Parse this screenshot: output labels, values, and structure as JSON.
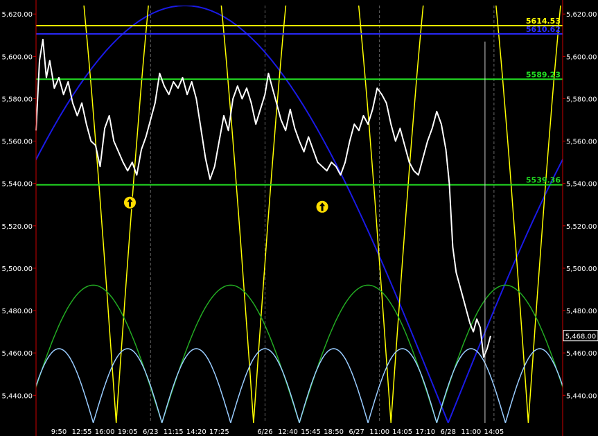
{
  "chart_data": {
    "type": "line",
    "title": "",
    "xlabel": "",
    "ylabel": "",
    "ylim": [
      5427,
      5624
    ],
    "y_ticks": [
      5440,
      5460,
      5480,
      5500,
      5520,
      5540,
      5560,
      5580,
      5600,
      5620
    ],
    "y_tick_labels": [
      "5,440.00",
      "5,460.00",
      "5,480.00",
      "5,500.00",
      "5,520.00",
      "5,540.00",
      "5,560.00",
      "5,580.00",
      "5,600.00",
      "5,620.00"
    ],
    "x_tick_labels": [
      "9:50",
      "12:55",
      "16:00",
      "19:05",
      "6/23",
      "11:15",
      "14:20",
      "17:25",
      "6/26",
      "12:40",
      "15:45",
      "18:50",
      "6/27",
      "11:00",
      "14:05",
      "17:10",
      "6/28",
      "11:00",
      "14:05"
    ],
    "session_separators": [
      5,
      10,
      15,
      20
    ],
    "x_range": [
      0,
      23
    ],
    "x_tick_positions": [
      1,
      2,
      3,
      4,
      5,
      6,
      7,
      8,
      10,
      11,
      12,
      13,
      14,
      15,
      16,
      17,
      18,
      19,
      20
    ],
    "price_series": {
      "name": "",
      "color": "#ffffff",
      "points": [
        [
          0,
          5565
        ],
        [
          0.15,
          5598
        ],
        [
          0.3,
          5608
        ],
        [
          0.45,
          5590
        ],
        [
          0.6,
          5598
        ],
        [
          0.8,
          5585
        ],
        [
          1.0,
          5590
        ],
        [
          1.2,
          5582
        ],
        [
          1.4,
          5588
        ],
        [
          1.6,
          5578
        ],
        [
          1.8,
          5572
        ],
        [
          2.0,
          5578
        ],
        [
          2.2,
          5568
        ],
        [
          2.4,
          5560
        ],
        [
          2.6,
          5558
        ],
        [
          2.8,
          5548
        ],
        [
          3.0,
          5566
        ],
        [
          3.2,
          5572
        ],
        [
          3.4,
          5560
        ],
        [
          3.6,
          5555
        ],
        [
          3.8,
          5550
        ],
        [
          4.0,
          5546
        ],
        [
          4.2,
          5550
        ],
        [
          4.4,
          5544
        ],
        [
          4.6,
          5556
        ],
        [
          4.8,
          5562
        ],
        [
          5.0,
          5570
        ],
        [
          5.2,
          5578
        ],
        [
          5.4,
          5592
        ],
        [
          5.6,
          5586
        ],
        [
          5.8,
          5582
        ],
        [
          6.0,
          5588
        ],
        [
          6.2,
          5585
        ],
        [
          6.4,
          5590
        ],
        [
          6.6,
          5582
        ],
        [
          6.8,
          5588
        ],
        [
          7.0,
          5580
        ],
        [
          7.2,
          5566
        ],
        [
          7.4,
          5552
        ],
        [
          7.6,
          5542
        ],
        [
          7.8,
          5548
        ],
        [
          8.0,
          5560
        ],
        [
          8.2,
          5572
        ],
        [
          8.4,
          5565
        ],
        [
          8.6,
          5580
        ],
        [
          8.8,
          5586
        ],
        [
          9.0,
          5580
        ],
        [
          9.2,
          5585
        ],
        [
          9.4,
          5578
        ],
        [
          9.6,
          5568
        ],
        [
          9.8,
          5575
        ],
        [
          10.0,
          5582
        ],
        [
          10.15,
          5592
        ],
        [
          10.3,
          5586
        ],
        [
          10.5,
          5578
        ],
        [
          10.7,
          5570
        ],
        [
          10.9,
          5565
        ],
        [
          11.1,
          5575
        ],
        [
          11.3,
          5566
        ],
        [
          11.5,
          5560
        ],
        [
          11.7,
          5555
        ],
        [
          11.9,
          5562
        ],
        [
          12.1,
          5556
        ],
        [
          12.3,
          5550
        ],
        [
          12.5,
          5548
        ],
        [
          12.7,
          5546
        ],
        [
          12.9,
          5550
        ],
        [
          13.1,
          5548
        ],
        [
          13.3,
          5544
        ],
        [
          13.5,
          5550
        ],
        [
          13.7,
          5560
        ],
        [
          13.9,
          5568
        ],
        [
          14.1,
          5565
        ],
        [
          14.3,
          5572
        ],
        [
          14.5,
          5568
        ],
        [
          14.7,
          5575
        ],
        [
          14.9,
          5585
        ],
        [
          15.1,
          5582
        ],
        [
          15.3,
          5578
        ],
        [
          15.5,
          5568
        ],
        [
          15.7,
          5560
        ],
        [
          15.9,
          5566
        ],
        [
          16.1,
          5558
        ],
        [
          16.3,
          5550
        ],
        [
          16.5,
          5546
        ],
        [
          16.7,
          5544
        ],
        [
          16.9,
          5552
        ],
        [
          17.1,
          5560
        ],
        [
          17.3,
          5566
        ],
        [
          17.5,
          5574
        ],
        [
          17.7,
          5568
        ],
        [
          17.9,
          5556
        ],
        [
          18.05,
          5540
        ],
        [
          18.2,
          5510
        ],
        [
          18.35,
          5498
        ],
        [
          18.5,
          5492
        ],
        [
          18.65,
          5486
        ],
        [
          18.8,
          5480
        ],
        [
          18.95,
          5474
        ],
        [
          19.1,
          5470
        ],
        [
          19.25,
          5476
        ],
        [
          19.4,
          5472
        ],
        [
          19.55,
          5458
        ],
        [
          19.7,
          5462
        ],
        [
          19.85,
          5468
        ]
      ]
    },
    "horizontal_levels": [
      {
        "value": 5614.53,
        "label": "5614.53",
        "color": "#ffff00"
      },
      {
        "value": 5610.62,
        "label": "5610.62",
        "color": "#2a2aff"
      },
      {
        "value": 5589.23,
        "label": "5589.23",
        "color": "#22dd22"
      },
      {
        "value": 5539.36,
        "label": "5539.36",
        "color": "#22dd22"
      }
    ],
    "current_price_label": "5,468.00",
    "current_price_value": 5468,
    "annotations": [
      {
        "type": "up-arrow-marker",
        "x": 4.1,
        "y": 5531
      },
      {
        "type": "up-arrow-marker",
        "x": 12.5,
        "y": 5529
      }
    ],
    "cycle_arcs": [
      {
        "name": "",
        "color": "#1a1ae6",
        "period": 23,
        "start": -5,
        "peak": 5624
      },
      {
        "name": "",
        "color": "#ffff00",
        "period": 6,
        "start": 9.5,
        "peak": 5720
      },
      {
        "name": "",
        "color": "#22aa22",
        "period": 6,
        "start": -0.5,
        "peak": 5492
      },
      {
        "name": "",
        "color": "#99ccff",
        "period": 3,
        "start": -0.5,
        "peak": 5462
      }
    ],
    "grid": false,
    "colors": {
      "background": "#000000",
      "price_line": "#ffffff",
      "axis_line": "#cc0000",
      "separator": "#666666",
      "marker_fill": "#ffdd00"
    }
  }
}
